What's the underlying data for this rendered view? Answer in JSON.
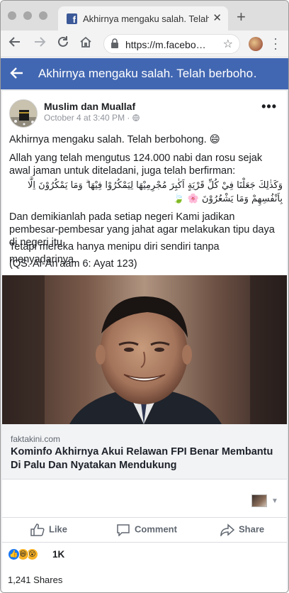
{
  "browser": {
    "tab_title": "Akhirnya mengaku salah. Telah berbohong.",
    "url": "https://m.facebo…",
    "favicon_letter": "f"
  },
  "fb_header": {
    "title": "Akhirnya mengaku salah. Telah berboho…",
    "accent": "#4267b2"
  },
  "post": {
    "author": "Muslim dan Muallaf",
    "timestamp": "October 4 at 3:40 PM · ",
    "paragraphs": [
      "Akhirnya mengaku salah. Telah berbohong. 😄",
      "Allah yang telah mengutus 124.000 nabi dan rosu sejak awal jaman untuk diteladani, juga telah berfirman:",
      "وَكَذٰلِكَ جَعَلْنَا فِيْ كُلِّ قَرْيَةٍ اَكٰبِرَ مُجْرِمِيْهَا لِيَمْكُرُوْا فِيْهَا ۗ وَمَا يَمْكُرُوْنَ اِلَّا بِاَنْفُسِهِمْ وَمَا يَشْعُرُوْنَ 🌸 🍃",
      "Dan demikianlah pada setiap negeri Kami jadikan pembesar-pembesar yang jahat agar melakukan tipu daya di negeri itu.",
      "Tetapi mereka hanya menipu diri sendiri tanpa menyadarinya.",
      "(QS. Al-An'aam 6: Ayat 123)"
    ],
    "link": {
      "domain": "faktakini.com",
      "headline": "Kominfo Akhirnya Akui Relawan FPI Benar Membantu Di Palu Dan Nyatakan Mendukung"
    },
    "actions": {
      "like": "Like",
      "comment": "Comment",
      "share": "Share"
    },
    "reactions_count": "1K",
    "shares_text": "1,241 Shares"
  }
}
